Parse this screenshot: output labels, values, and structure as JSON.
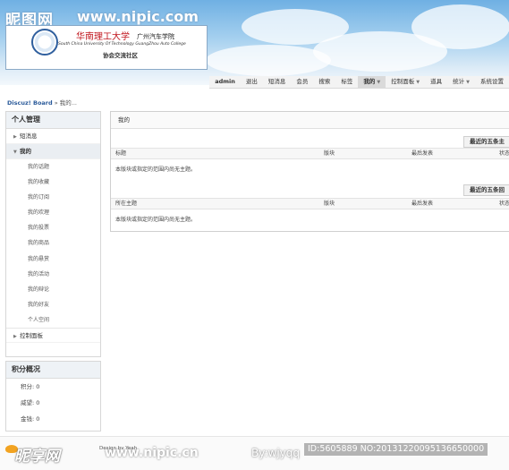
{
  "watermark": {
    "site_cn": "昵图网",
    "site_url": "www.nipic.com",
    "footer_cn": "昵享网",
    "footer_url": "www.nipic.cn",
    "author": "By:wjyqq",
    "image_id": "ID:5605889 NO:20131220095136650000"
  },
  "header": {
    "school_cn": "华南理工大学",
    "school_cn2": "广州汽车学院",
    "school_en": "South China University Of Technology GuangZhou Auto College",
    "community": "协会交流社区"
  },
  "topnav": {
    "items": [
      "admin",
      "退出",
      "短消息",
      "会员",
      "搜索",
      "标签",
      "我的",
      "控制面板",
      "道具",
      "统计",
      "系统设置"
    ]
  },
  "breadcrumb": {
    "home": "Discuz! Board",
    "sep": "»",
    "current": "我的..."
  },
  "sidebar": {
    "title": "个人管理",
    "items": [
      {
        "label": "短消息"
      },
      {
        "label": "我的"
      },
      {
        "label": "控制面板"
      }
    ],
    "sub_items": [
      "我的话题",
      "我的收藏",
      "我的订阅",
      "我的欢理",
      "我的投票",
      "我的商品",
      "我的悬赏",
      "我的活动",
      "我的辩论",
      "我的好友",
      "个人空间"
    ]
  },
  "credits": {
    "title": "积分概况",
    "rows": [
      "积分: 0",
      "威望: 0",
      "金钱: 0"
    ]
  },
  "main": {
    "title": "我的",
    "section1": {
      "tag": "最近的五条主",
      "headers": [
        "标题",
        "版块",
        "最后发表",
        "状态"
      ],
      "empty": "本版块或指定的范围内尚无主题。"
    },
    "section2": {
      "tag": "最近的五条回",
      "headers": [
        "所在主题",
        "版块",
        "最后发表",
        "状态"
      ],
      "empty": "本版块或指定的范围内尚无主题。"
    }
  },
  "footer": {
    "design": "Design by Yeah"
  },
  "colors": {
    "link": "#2a5a9a",
    "logo_red": "#c0141c"
  }
}
